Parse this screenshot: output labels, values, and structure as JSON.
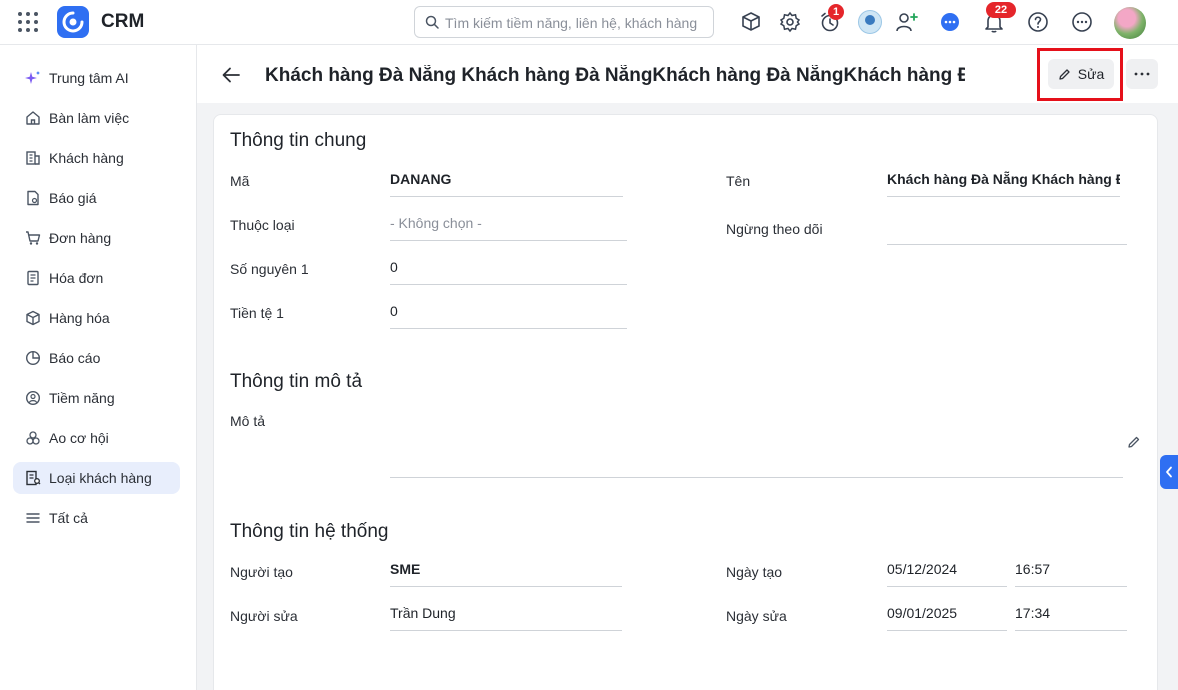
{
  "app": {
    "title": "CRM"
  },
  "search": {
    "placeholder": "Tìm kiếm tiềm năng, liên hệ, khách hàng"
  },
  "badges": {
    "timer": "1",
    "notifications": "22"
  },
  "sidebar": {
    "items": [
      {
        "label": "Trung tâm AI",
        "icon": "sparkle-icon"
      },
      {
        "label": "Bàn làm việc",
        "icon": "home-icon"
      },
      {
        "label": "Khách hàng",
        "icon": "building-icon"
      },
      {
        "label": "Báo giá",
        "icon": "quote-icon"
      },
      {
        "label": "Đơn hàng",
        "icon": "cart-icon"
      },
      {
        "label": "Hóa đơn",
        "icon": "invoice-icon"
      },
      {
        "label": "Hàng hóa",
        "icon": "box-icon"
      },
      {
        "label": "Báo cáo",
        "icon": "pie-chart-icon"
      },
      {
        "label": "Tiềm năng",
        "icon": "target-icon"
      },
      {
        "label": "Ao cơ hội",
        "icon": "opportunity-icon"
      },
      {
        "label": "Loại khách hàng",
        "icon": "customer-type-icon",
        "active": true
      },
      {
        "label": "Tất cả",
        "icon": "menu-icon"
      }
    ]
  },
  "header": {
    "title": "Khách hàng Đà Nẵng Khách hàng Đà NẵngKhách hàng Đà NẵngKhách hàng Đ...",
    "edit_label": "Sửa"
  },
  "sections": {
    "general": {
      "title": "Thông tin chung",
      "ma_label": "Mã",
      "ma_value": "DANANG",
      "ten_label": "Tên",
      "ten_value": "Khách hàng Đà Nẵng Khách hàng Đ...",
      "thuoc_loai_label": "Thuộc loại",
      "thuoc_loai_value": "- Không chọn -",
      "ngung_label": "Ngừng theo dõi",
      "ngung_value": "",
      "so_nguyen_label": "Số nguyên 1",
      "so_nguyen_value": "0",
      "tien_te_label": "Tiền tệ 1",
      "tien_te_value": "0"
    },
    "description": {
      "title": "Thông tin mô tả",
      "mo_ta_label": "Mô tả",
      "mo_ta_value": ""
    },
    "system": {
      "title": "Thông tin hệ thống",
      "nguoi_tao_label": "Người tạo",
      "nguoi_tao_value": "SME",
      "ngay_tao_label": "Ngày tạo",
      "ngay_tao_date": "05/12/2024",
      "ngay_tao_time": "16:57",
      "nguoi_sua_label": "Người sửa",
      "nguoi_sua_value": "Trần Dung",
      "ngay_sua_label": "Ngày sửa",
      "ngay_sua_date": "09/01/2025",
      "ngay_sua_time": "17:34"
    }
  },
  "colors": {
    "accent": "#2f6ff2",
    "highlight": "#e5101a",
    "badge": "#e5262b"
  }
}
